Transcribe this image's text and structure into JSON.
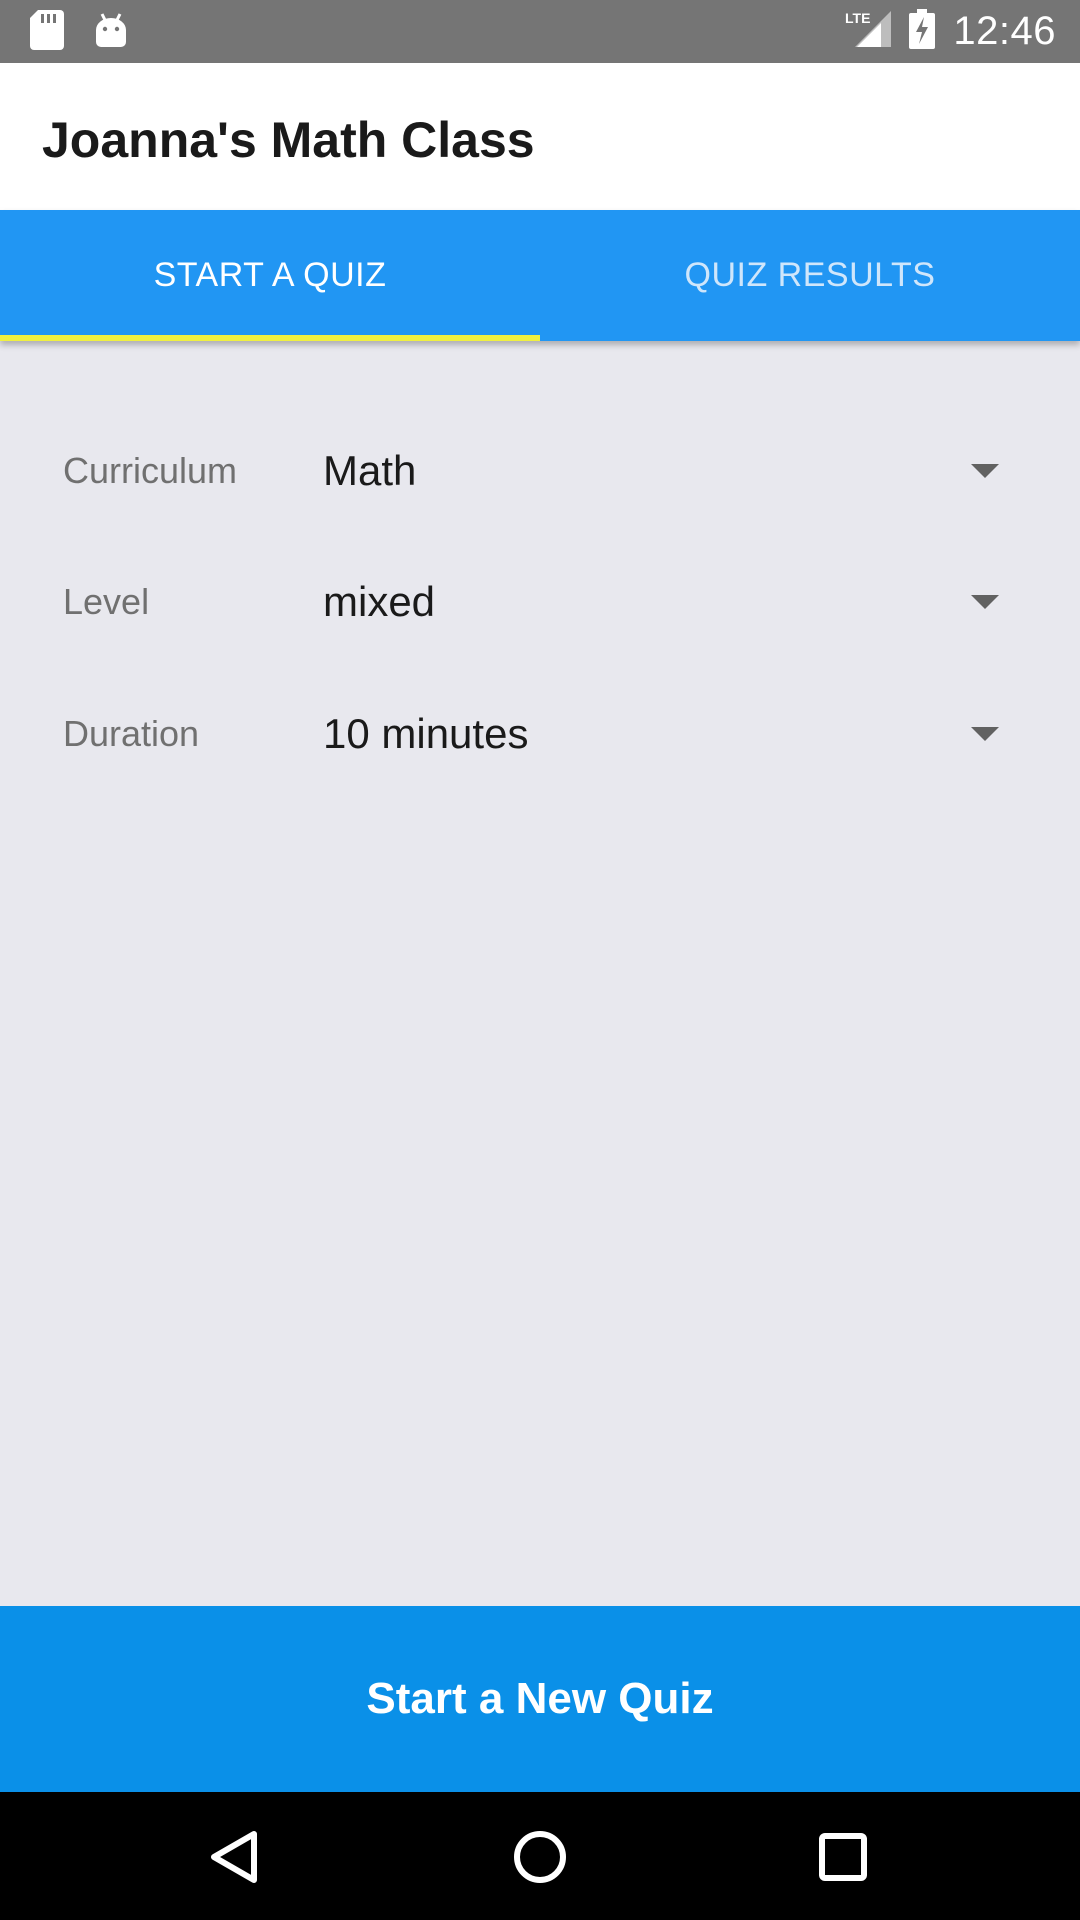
{
  "status_bar": {
    "time": "12:46",
    "network": "LTE",
    "icons": [
      "sd-card-icon",
      "android-icon",
      "signal-icon",
      "battery-charging-icon"
    ]
  },
  "app_bar": {
    "title": "Joanna's Math Class"
  },
  "tabs": [
    {
      "label": "START A QUIZ",
      "active": true
    },
    {
      "label": "QUIZ RESULTS",
      "active": false
    }
  ],
  "form": {
    "rows": [
      {
        "label": "Curriculum",
        "value": "Math"
      },
      {
        "label": "Level",
        "value": "mixed"
      },
      {
        "label": "Duration",
        "value": "10 minutes"
      }
    ]
  },
  "start_button": {
    "label": "Start a New Quiz"
  },
  "nav_bar": {
    "icons": [
      "back-icon",
      "home-icon",
      "recents-icon"
    ]
  },
  "colors": {
    "primary": "#2196f3",
    "button": "#0a90e8",
    "indicator": "#f0f040",
    "background": "#e8e8ee"
  }
}
